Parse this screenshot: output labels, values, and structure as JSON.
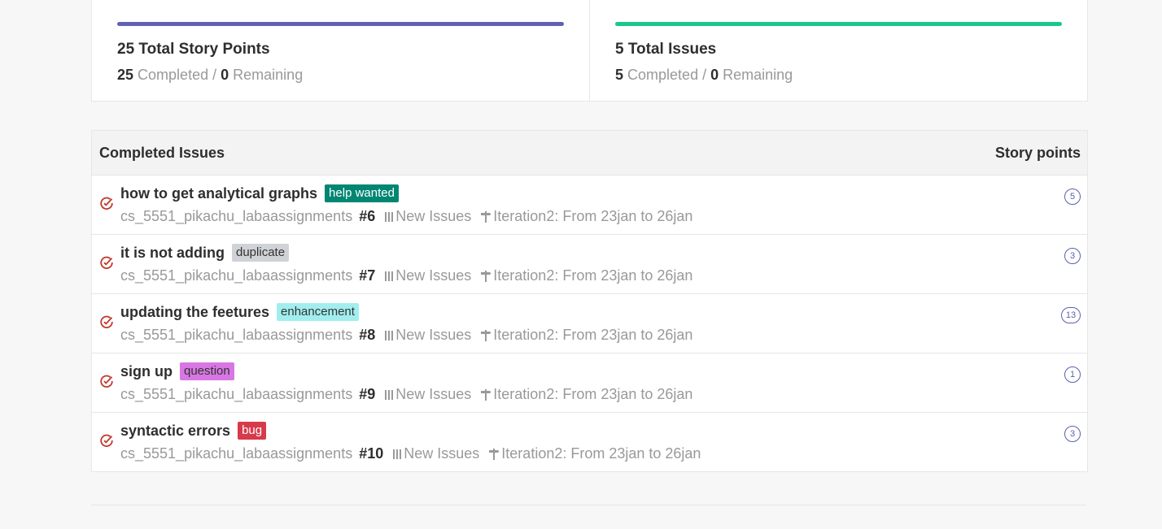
{
  "summary": {
    "story_points": {
      "title": "25 Total Story Points",
      "completed": "25",
      "completed_label": "Completed /",
      "remaining": "0",
      "remaining_label": "Remaining",
      "bar_color": "#6061b3"
    },
    "issues": {
      "title": "5 Total Issues",
      "completed": "5",
      "completed_label": "Completed /",
      "remaining": "0",
      "remaining_label": "Remaining",
      "bar_color": "#17c98a"
    }
  },
  "table": {
    "header_left": "Completed Issues",
    "header_right": "Story points",
    "rows": [
      {
        "title": "how to get analytical graphs",
        "label": "help wanted",
        "label_bg": "#008672",
        "label_fg": "#ffffff",
        "repo": "cs_5551_pikachu_labaassignments",
        "number": "#6",
        "pipeline": "New Issues",
        "milestone": "Iteration2: From 23jan to 26jan",
        "points": "5"
      },
      {
        "title": "it is not adding",
        "label": "duplicate",
        "label_bg": "#cfd3d7",
        "label_fg": "#333333",
        "repo": "cs_5551_pikachu_labaassignments",
        "number": "#7",
        "pipeline": "New Issues",
        "milestone": "Iteration2: From 23jan to 26jan",
        "points": "3"
      },
      {
        "title": "updating the feetures",
        "label": "enhancement",
        "label_bg": "#a2eeef",
        "label_fg": "#333333",
        "repo": "cs_5551_pikachu_labaassignments",
        "number": "#8",
        "pipeline": "New Issues",
        "milestone": "Iteration2: From 23jan to 26jan",
        "points": "13"
      },
      {
        "title": "sign up",
        "label": "question",
        "label_bg": "#d876e3",
        "label_fg": "#333333",
        "repo": "cs_5551_pikachu_labaassignments",
        "number": "#9",
        "pipeline": "New Issues",
        "milestone": "Iteration2: From 23jan to 26jan",
        "points": "1"
      },
      {
        "title": "syntactic errors",
        "label": "bug",
        "label_bg": "#d73a4a",
        "label_fg": "#ffffff",
        "repo": "cs_5551_pikachu_labaassignments",
        "number": "#10",
        "pipeline": "New Issues",
        "milestone": "Iteration2: From 23jan to 26jan",
        "points": "3"
      }
    ]
  },
  "icons": {
    "closed_issue": "closed-issue-icon",
    "pipeline": "board-column-icon",
    "milestone": "milestone-signpost-icon"
  },
  "colors": {
    "closed_icon": "#c0392b",
    "points_badge": "#5b5fb0"
  }
}
